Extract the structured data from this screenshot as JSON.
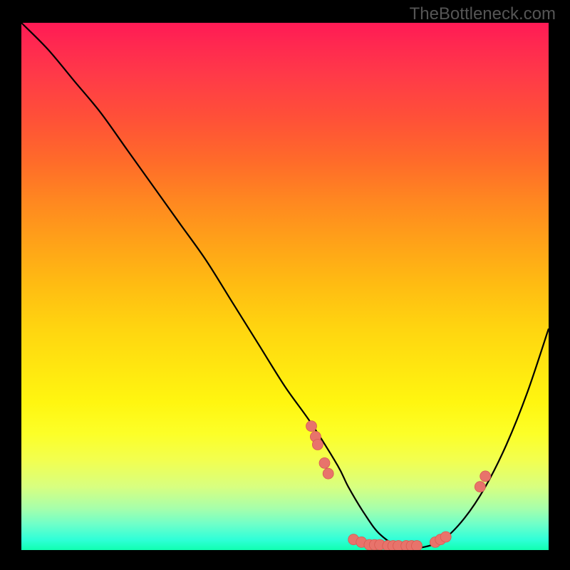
{
  "watermark": "TheBottleneck.com",
  "chart_data": {
    "type": "line",
    "title": "",
    "xlabel": "",
    "ylabel": "",
    "xlim": [
      0,
      100
    ],
    "ylim": [
      0,
      100
    ],
    "series": [
      {
        "name": "curve",
        "x": [
          0,
          5,
          10,
          15,
          20,
          25,
          30,
          35,
          40,
          45,
          50,
          55,
          60,
          62,
          65,
          68,
          72,
          76,
          80,
          84,
          88,
          92,
          96,
          100
        ],
        "y": [
          100,
          95,
          89,
          83,
          76,
          69,
          62,
          55,
          47,
          39,
          31,
          24,
          16,
          12,
          7,
          3,
          0.5,
          0.5,
          2,
          6,
          12,
          20,
          30,
          42
        ]
      }
    ],
    "points": [
      {
        "x": 55.0,
        "y": 23.5
      },
      {
        "x": 55.8,
        "y": 21.5
      },
      {
        "x": 56.2,
        "y": 20.0
      },
      {
        "x": 57.5,
        "y": 16.5
      },
      {
        "x": 58.2,
        "y": 14.5
      },
      {
        "x": 63.0,
        "y": 2.0
      },
      {
        "x": 64.5,
        "y": 1.5
      },
      {
        "x": 66.0,
        "y": 1.0
      },
      {
        "x": 67.0,
        "y": 1.0
      },
      {
        "x": 68.0,
        "y": 1.0
      },
      {
        "x": 69.5,
        "y": 0.8
      },
      {
        "x": 70.5,
        "y": 0.8
      },
      {
        "x": 71.5,
        "y": 0.8
      },
      {
        "x": 73.0,
        "y": 0.8
      },
      {
        "x": 74.0,
        "y": 0.8
      },
      {
        "x": 75.0,
        "y": 0.8
      },
      {
        "x": 78.5,
        "y": 1.5
      },
      {
        "x": 79.5,
        "y": 2.0
      },
      {
        "x": 80.5,
        "y": 2.5
      },
      {
        "x": 87.0,
        "y": 12.0
      },
      {
        "x": 88.0,
        "y": 14.0
      }
    ],
    "gradient_background": true,
    "dot_color": "#e8736b"
  }
}
